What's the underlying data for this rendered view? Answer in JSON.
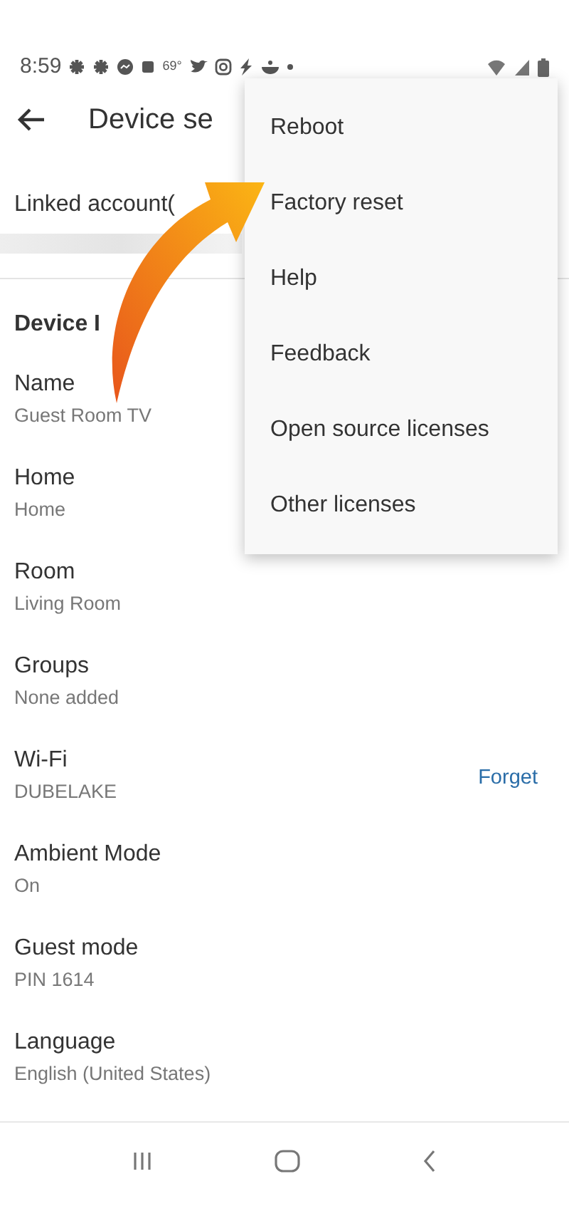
{
  "status_bar": {
    "time": "8:59",
    "temperature": "69°"
  },
  "app_bar": {
    "title": "Device se"
  },
  "linked_account": {
    "label": "Linked account("
  },
  "section": {
    "title": "Device I"
  },
  "settings": [
    {
      "label": "Name",
      "value": "Guest Room TV"
    },
    {
      "label": "Home",
      "value": "Home"
    },
    {
      "label": "Room",
      "value": "Living Room"
    },
    {
      "label": "Groups",
      "value": "None added"
    },
    {
      "label": "Wi-Fi",
      "value": "DUBELAKE",
      "action": "Forget"
    },
    {
      "label": "Ambient Mode",
      "value": "On"
    },
    {
      "label": "Guest mode",
      "value": "PIN 1614"
    },
    {
      "label": "Language",
      "value": "English (United States)"
    }
  ],
  "menu": {
    "items": [
      "Reboot",
      "Factory reset",
      "Help",
      "Feedback",
      "Open source licenses",
      "Other licenses"
    ]
  }
}
